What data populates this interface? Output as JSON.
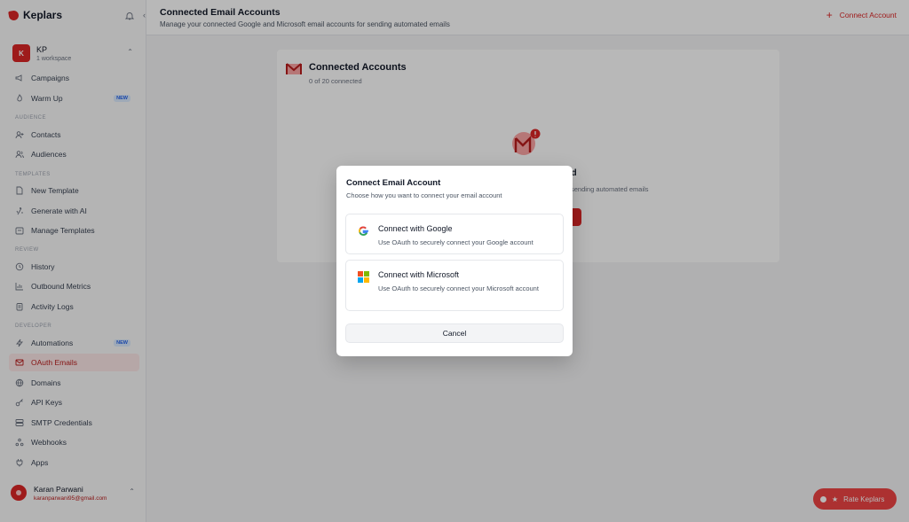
{
  "brand": {
    "name": "Keplars"
  },
  "workspace": {
    "initials": "K",
    "name": "KP",
    "subtitle": "1 workspace"
  },
  "nav": {
    "campaigns": "Campaigns",
    "warmup": "Warm Up",
    "warmup_badge": "NEW",
    "section_audience": "AUDIENCE",
    "contacts": "Contacts",
    "audiences": "Audiences",
    "section_templates": "TEMPLATES",
    "new_template": "New Template",
    "generate_ai": "Generate with AI",
    "manage_templates": "Manage Templates",
    "section_review": "REVIEW",
    "history": "History",
    "outbound_metrics": "Outbound Metrics",
    "activity_logs": "Activity Logs",
    "section_developer": "DEVELOPER",
    "automations": "Automations",
    "automations_badge": "NEW",
    "oauth_emails": "OAuth Emails",
    "domains": "Domains",
    "api_keys": "API Keys",
    "smtp": "SMTP Credentials",
    "webhooks": "Webhooks",
    "apps": "Apps"
  },
  "user": {
    "name": "Karan Parwani",
    "email": "karanparwani95@gmail.com"
  },
  "header": {
    "title": "Connected Email Accounts",
    "subtitle": "Manage your connected Google and Microsoft email accounts for sending automated emails",
    "connect_label": "Connect Account"
  },
  "card": {
    "title": "Connected Accounts",
    "subtitle": "0 of 20 connected",
    "empty_title_partial": "cted",
    "empty_desc_partial": "sending automated emails"
  },
  "modal": {
    "title": "Connect Email Account",
    "subtitle": "Choose how you want to connect your email account",
    "google_title": "Connect with Google",
    "google_desc": "Use OAuth to securely connect your Google account",
    "microsoft_title": "Connect with Microsoft",
    "microsoft_desc": "Use OAuth to securely connect your Microsoft account",
    "cancel": "Cancel"
  },
  "rate": {
    "label": "Rate Keplars"
  },
  "colors": {
    "accent": "#dc2626",
    "badge": "#2563eb"
  }
}
